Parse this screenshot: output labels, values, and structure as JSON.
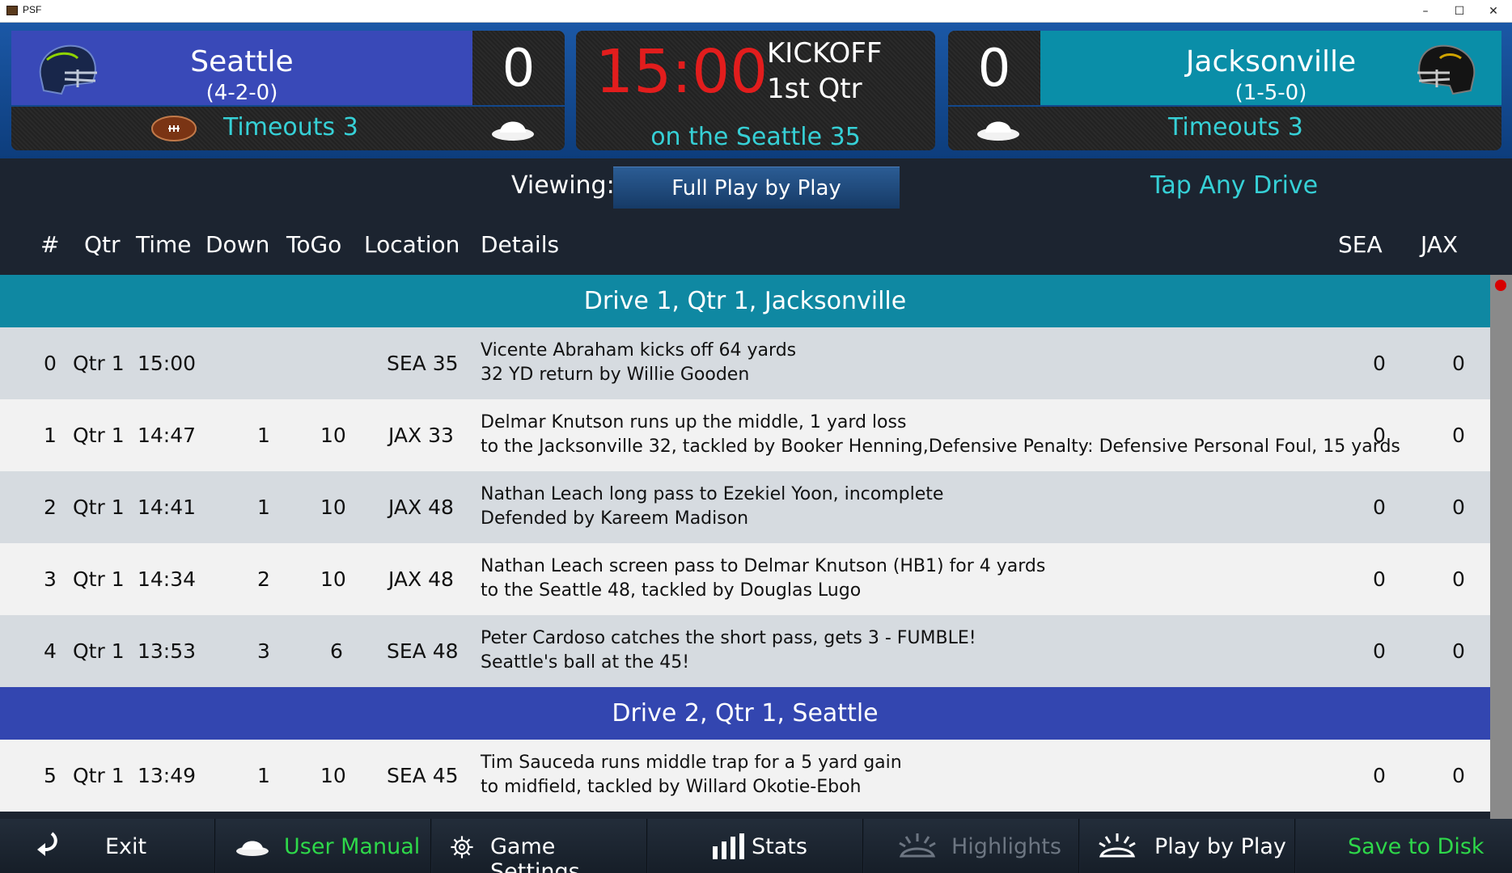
{
  "window": {
    "title": "PSF",
    "minimize": "–",
    "maximize": "☐",
    "close": "✕"
  },
  "scoreboard": {
    "home": {
      "name": "Seattle",
      "record": "(4-2-0)",
      "score": "0",
      "timeouts": "Timeouts 3",
      "color": "#3949b8"
    },
    "away": {
      "name": "Jacksonville",
      "record": "(1-5-0)",
      "score": "0",
      "timeouts": "Timeouts 3",
      "color": "#0a8ea8"
    },
    "clock": "15:00",
    "status": "KICKOFF",
    "quarter": "1st Qtr",
    "ball_on": "on the Seattle 35",
    "clock_color": "#e21d1d",
    "accent_color": "#36d0d6"
  },
  "viewing": {
    "label": "Viewing:",
    "selected": "Full Play by Play",
    "hint": "Tap Any Drive"
  },
  "columns": {
    "num": "#",
    "qtr": "Qtr",
    "time": "Time",
    "down": "Down",
    "togo": "ToGo",
    "location": "Location",
    "details": "Details",
    "home": "SEA",
    "away": "JAX"
  },
  "drives": [
    {
      "title": "Drive 1, Qtr 1, Jacksonville",
      "color": "#0f88a2"
    },
    {
      "title": "Drive 2, Qtr 1, Seattle",
      "color": "#3346b0"
    }
  ],
  "plays": [
    {
      "num": "0",
      "qtr": "Qtr 1",
      "time": "15:00",
      "down": "",
      "togo": "",
      "location": "SEA 35",
      "line1": "Vicente Abraham kicks off 64 yards",
      "line2": "32 YD return by Willie Gooden",
      "home": "0",
      "away": "0"
    },
    {
      "num": "1",
      "qtr": "Qtr 1",
      "time": "14:47",
      "down": "1",
      "togo": "10",
      "location": "JAX 33",
      "line1": "Delmar Knutson runs up the middle, 1 yard loss",
      "line2": "to the Jacksonville 32, tackled by Booker Henning,Defensive Penalty: Defensive Personal Foul, 15 yards",
      "home": "0",
      "away": "0"
    },
    {
      "num": "2",
      "qtr": "Qtr 1",
      "time": "14:41",
      "down": "1",
      "togo": "10",
      "location": "JAX 48",
      "line1": "Nathan Leach long pass to Ezekiel Yoon, incomplete",
      "line2": "Defended by Kareem Madison",
      "home": "0",
      "away": "0"
    },
    {
      "num": "3",
      "qtr": "Qtr 1",
      "time": "14:34",
      "down": "2",
      "togo": "10",
      "location": "JAX 48",
      "line1": "Nathan Leach screen pass to Delmar Knutson (HB1) for 4 yards",
      "line2": "to the Seattle 48, tackled by Douglas Lugo",
      "home": "0",
      "away": "0"
    },
    {
      "num": "4",
      "qtr": "Qtr 1",
      "time": "13:53",
      "down": "3",
      "togo": "6",
      "location": "SEA 48",
      "line1": "Peter Cardoso catches the short pass, gets 3 - FUMBLE!",
      "line2": "Seattle's ball at the 45!",
      "home": "0",
      "away": "0"
    },
    {
      "num": "5",
      "qtr": "Qtr 1",
      "time": "13:49",
      "down": "1",
      "togo": "10",
      "location": "SEA 45",
      "line1": "Tim Sauceda runs middle trap for a 5 yard gain",
      "line2": "to midfield, tackled by Willard Okotie-Eboh",
      "home": "0",
      "away": "0"
    }
  ],
  "toolbar": {
    "exit": "Exit",
    "manual": "User Manual",
    "settings": "Game Settings",
    "stats": "Stats",
    "highlights": "Highlights",
    "pbp": "Play by Play",
    "save": "Save to Disk",
    "green": "#2ed84a",
    "disabled": "#6d7682"
  }
}
